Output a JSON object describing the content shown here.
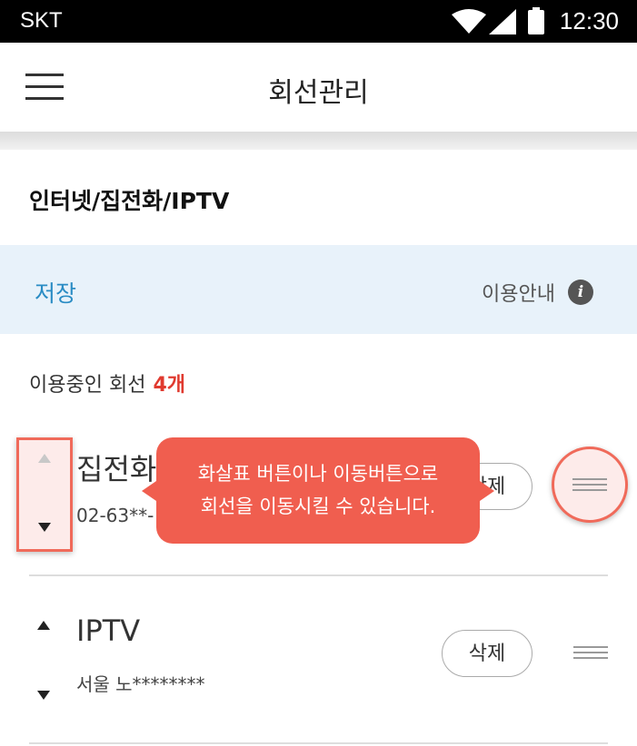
{
  "status_bar": {
    "carrier": "SKT",
    "time": "12:30"
  },
  "header": {
    "title": "회선관리"
  },
  "section": {
    "title": "인터넷/집전화/IPTV"
  },
  "info_bar": {
    "save_label": "저장",
    "guide_label": "이용안내",
    "guide_icon_glyph": "i"
  },
  "count": {
    "label": "이용중인 회선",
    "value": "4개"
  },
  "lines": [
    {
      "name": "집전화",
      "detail": "02-63**-",
      "delete_label": "삭제"
    },
    {
      "name": "IPTV",
      "detail": "서울 노********",
      "delete_label": "삭제"
    }
  ],
  "tooltip": {
    "line1": "화살표 버튼이나 이동버튼으로",
    "line2": "회선을 이동시킬 수 있습니다."
  },
  "colors": {
    "accent_red": "#f05e4f",
    "save_blue": "#2a8cc4",
    "info_bg": "#e8f2fa"
  }
}
